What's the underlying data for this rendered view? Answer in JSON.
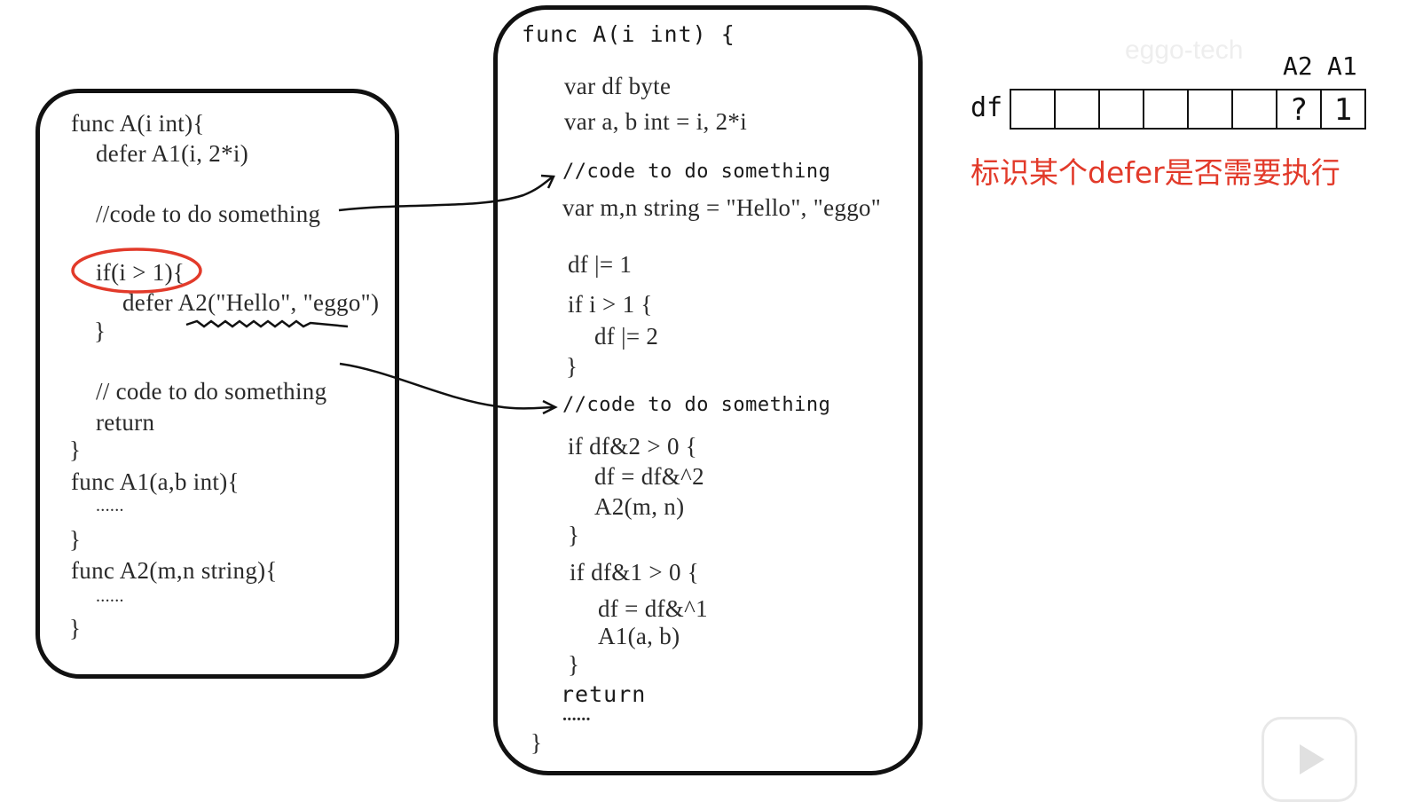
{
  "left_code": {
    "l1": "func A(i int){",
    "l2": "defer A1(i, 2*i)",
    "l3": "//code to do something",
    "l4": "if(i > 1){",
    "l5": "defer A2(\"Hello\", \"eggo\")",
    "l6": "}",
    "l7": "// code to do something",
    "l8": "return",
    "l9": "}",
    "l10": "func A1(a,b int){",
    "l11": "......",
    "l12": "}",
    "l13": "func A2(m,n string){",
    "l14": "......",
    "l15": "}"
  },
  "mid_code": {
    "m1": "func A(i int) {",
    "m2": "var df byte",
    "m3": "var a, b int = i, 2*i",
    "m4": "//code to do something",
    "m5": "var m,n string = \"Hello\", \"eggo\"",
    "m6": "df |= 1",
    "m7": "if i > 1 {",
    "m8": "df |= 2",
    "m9": "}",
    "m10": "//code to do something",
    "m11": "if df&2 > 0 {",
    "m12": "df = df&^2",
    "m13": "A2(m, n)",
    "m14": "}",
    "m15": "if df&1 > 0 {",
    "m16": "df = df&^1",
    "m17": "A1(a, b)",
    "m18": "}",
    "m19": "return",
    "m20": "......",
    "m21": "}"
  },
  "df_register": {
    "label": "df",
    "cells": [
      "",
      "",
      "",
      "",
      "",
      "",
      "?",
      "1"
    ],
    "bit_labels": [
      "A2",
      "A1"
    ]
  },
  "caption": "标识某个defer是否需要执行",
  "watermark": "eggo-tech",
  "colors": {
    "annotation_red": "#e23a2a",
    "line": "#111111"
  },
  "icons": [
    "play-icon"
  ]
}
